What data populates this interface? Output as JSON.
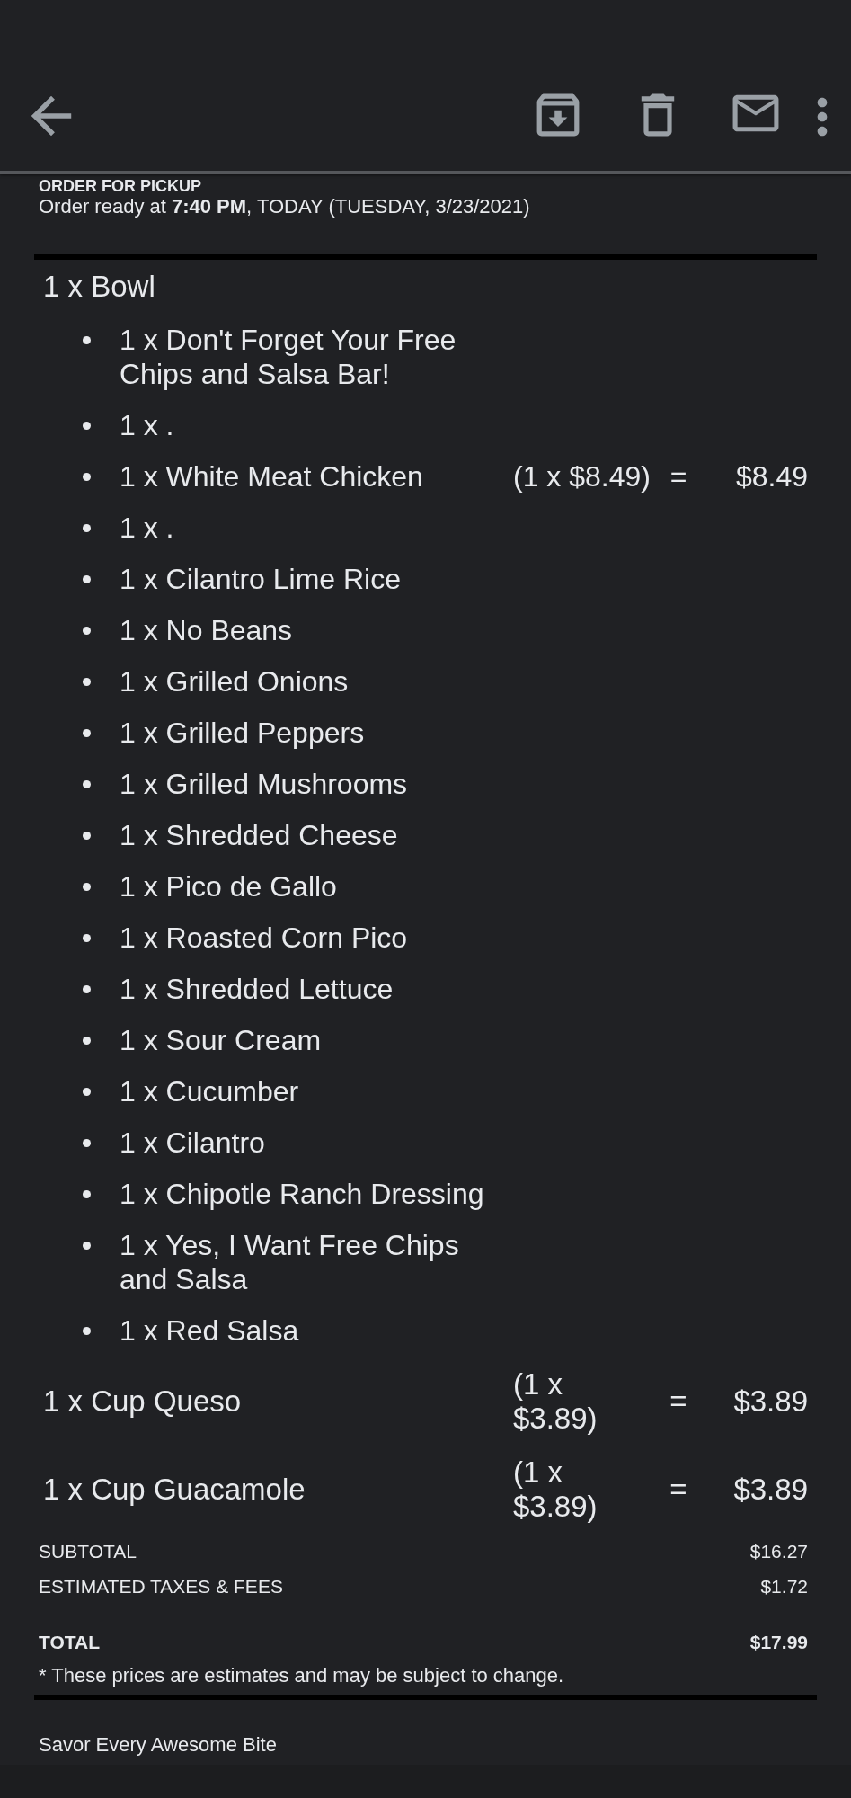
{
  "order": {
    "heading": "ORDER FOR PICKUP",
    "ready_line": "Order ready at **7:40 PM**, TODAY (TUESDAY, 3/23/2021)"
  },
  "items": [
    {
      "name": "1 x Bowl",
      "children": [
        {
          "name": "1 x Don't Forget Your Free Chips and Salsa Bar!"
        },
        {
          "name": "1 x ."
        },
        {
          "name": "1 x White Meat Chicken",
          "unit_price": "(1 x $8.49)",
          "equals": "=",
          "amount": "$8.49"
        },
        {
          "name": "1 x ."
        },
        {
          "name": "1 x Cilantro Lime Rice"
        },
        {
          "name": "1 x No Beans"
        },
        {
          "name": "1 x Grilled Onions"
        },
        {
          "name": "1 x Grilled Peppers"
        },
        {
          "name": "1 x Grilled Mushrooms"
        },
        {
          "name": "1 x Shredded Cheese"
        },
        {
          "name": "1 x Pico de Gallo"
        },
        {
          "name": "1 x Roasted Corn Pico"
        },
        {
          "name": "1 x Shredded Lettuce"
        },
        {
          "name": "1 x Sour Cream"
        },
        {
          "name": "1 x Cucumber"
        },
        {
          "name": "1 x Cilantro"
        },
        {
          "name": "1 x Chipotle Ranch Dressing"
        },
        {
          "name": "1 x Yes, I Want Free Chips and Salsa"
        },
        {
          "name": "1 x Red Salsa"
        }
      ]
    },
    {
      "name": "1 x Cup Queso",
      "unit_price": "(1 x $3.89)",
      "equals": "=",
      "amount": "$3.89"
    },
    {
      "name": "1 x Cup Guacamole",
      "unit_price": "(1 x $3.89)",
      "equals": "=",
      "amount": "$3.89"
    }
  ],
  "totals": [
    {
      "kind": "line",
      "label": "SUBTOTAL",
      "value": "$16.27"
    },
    {
      "kind": "line",
      "label": "ESTIMATED TAXES & FEES",
      "value": "$1.72"
    },
    {
      "kind": "total",
      "label": "TOTAL",
      "value": "$17.99"
    }
  ],
  "note": "* These prices are estimates and may be subject to change.",
  "footer": "Savor Every Awesome Bite"
}
